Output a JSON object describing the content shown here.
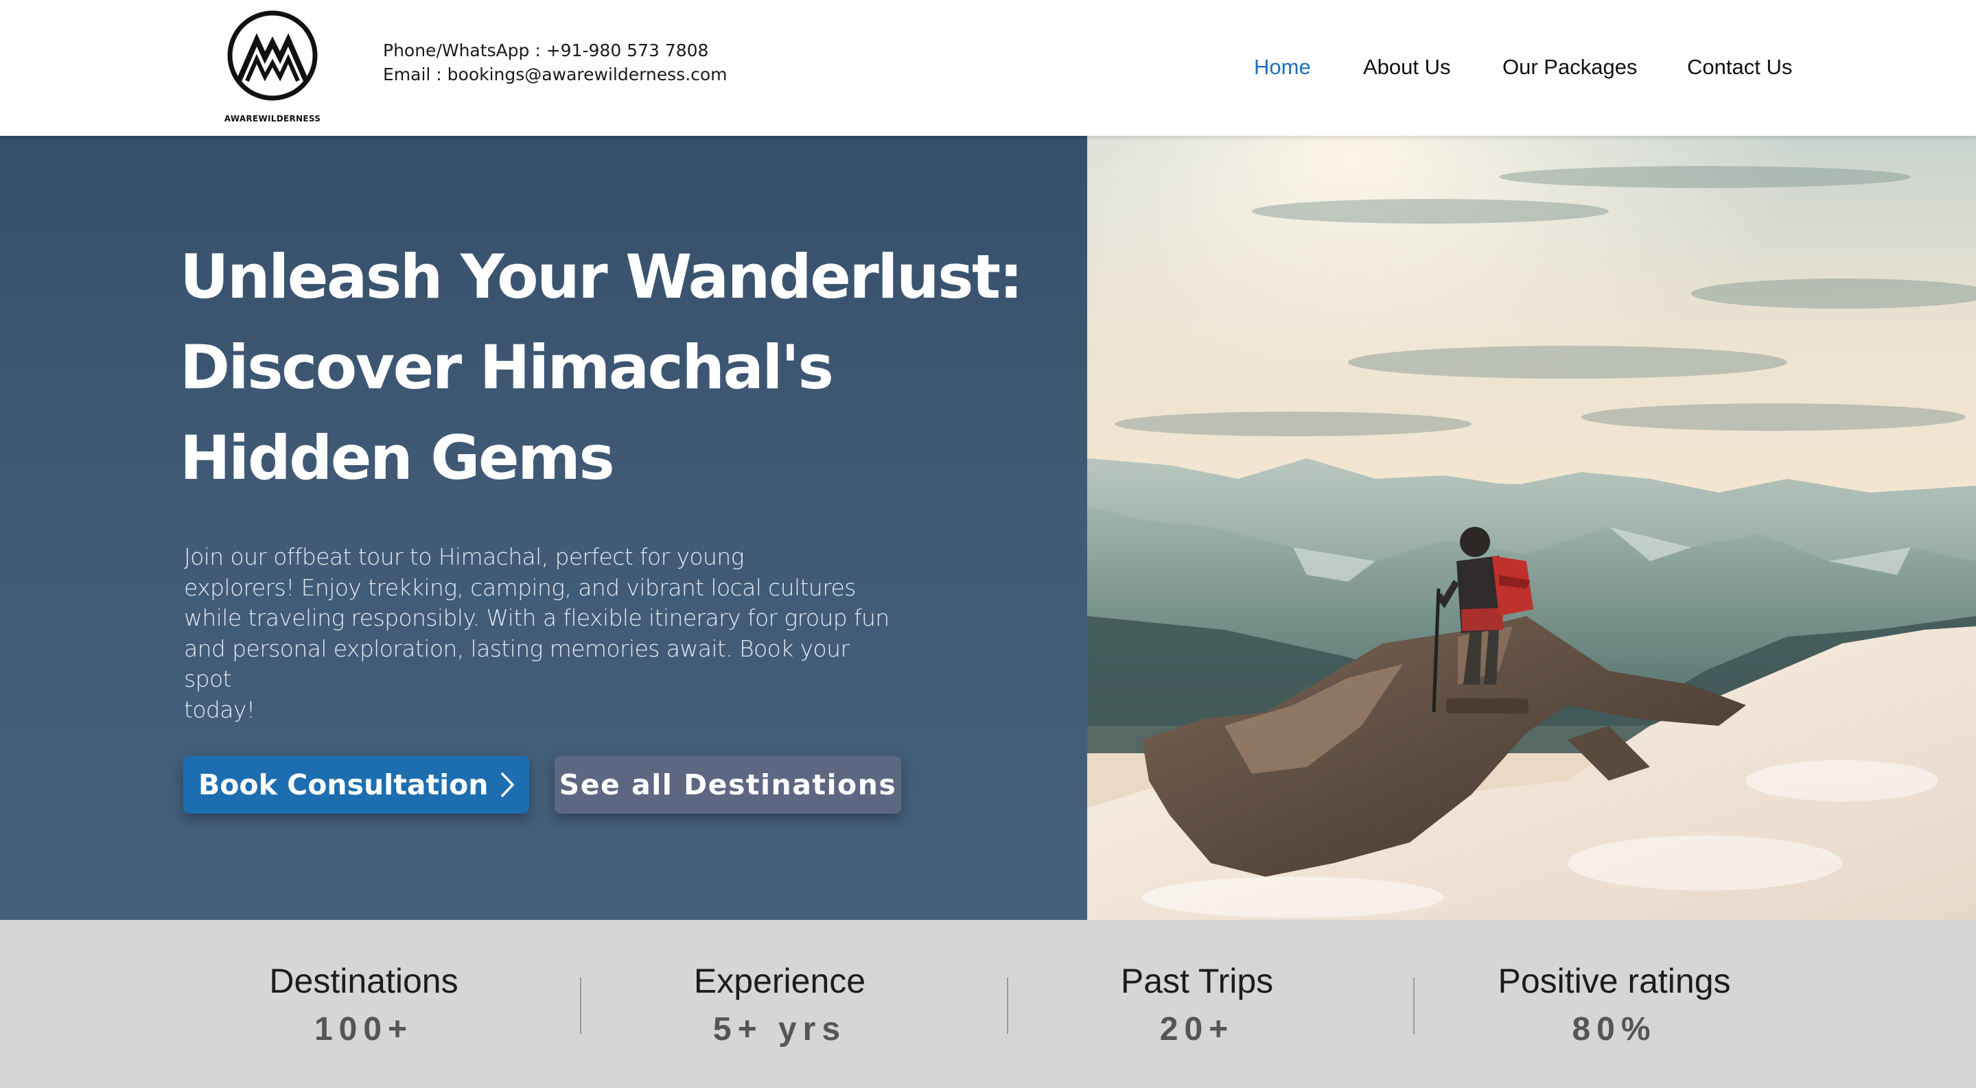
{
  "brand": {
    "logo_text": "AWAREWILDERNESS",
    "logo_icon": "mountain-peaks-logo"
  },
  "header": {
    "phone": "Phone/WhatsApp : +91-980 573 7808",
    "email": "Email : bookings@awarewilderness.com"
  },
  "nav": {
    "items": [
      {
        "label": "Home",
        "active": true
      },
      {
        "label": "About Us"
      },
      {
        "label": "Our Packages"
      },
      {
        "label": "Contact Us"
      }
    ]
  },
  "hero": {
    "headline_lines": [
      "Unleash Your Wanderlust:",
      "Discover Himachal's",
      "Hidden Gems"
    ],
    "description_lines": [
      "Join our offbeat tour to Himachal, perfect for young",
      "explorers! Enjoy trekking, camping, and vibrant local cultures",
      "while traveling responsibly. With a flexible itinerary for group fun",
      "and personal exploration, lasting memories await. Book your spot",
      "today!"
    ],
    "primary_button": "Book Consultation",
    "primary_button_icon": "chevron-right-icon",
    "secondary_button": "See all Destinations"
  },
  "stats": [
    {
      "title": "Destinations",
      "value": "100+"
    },
    {
      "title": "Experience",
      "value": "5+ yrs"
    },
    {
      "title": "Past Trips",
      "value": "20+"
    },
    {
      "title": "Positive ratings",
      "value": "80%"
    }
  ],
  "colors": {
    "nav_active": "#1f6ebd",
    "hero_bg": "#405a76",
    "primary_button": "#1d6eb0",
    "secondary_button": "#5d6781",
    "stats_bg": "#d6d6d6"
  }
}
